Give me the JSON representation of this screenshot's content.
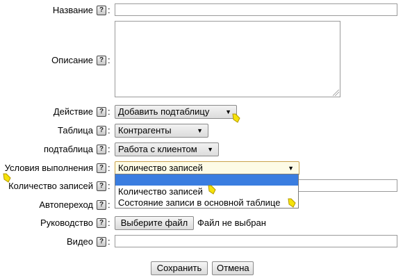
{
  "fields": {
    "name": {
      "label": "Название",
      "value": ""
    },
    "description": {
      "label": "Описание",
      "value": ""
    },
    "action": {
      "label": "Действие",
      "value": "Добавить подтаблицу"
    },
    "table": {
      "label": "Таблица",
      "value": "Контрагенты"
    },
    "subtable": {
      "label": "подтаблица",
      "value": "Работа с клиентом"
    },
    "conditions": {
      "label": "Условия выполнения",
      "value": "Количество записей",
      "options": [
        "",
        "Количество записей",
        "Состояние записи в основной таблице"
      ]
    },
    "record_count": {
      "label": "Количество записей",
      "value": ""
    },
    "auto_transition": {
      "label": "Автопереход"
    },
    "guide": {
      "label": "Руководство",
      "button": "Выберите файл",
      "status": "Файл не выбран"
    },
    "video": {
      "label": "Видео",
      "value": ""
    }
  },
  "help_glyph": "?",
  "colon": ":",
  "arrow_glyph": "▼",
  "buttons": {
    "save": "Сохранить",
    "cancel": "Отмена"
  },
  "colors": {
    "highlight": "#3a7de0",
    "cursor": "#f5e20a"
  }
}
